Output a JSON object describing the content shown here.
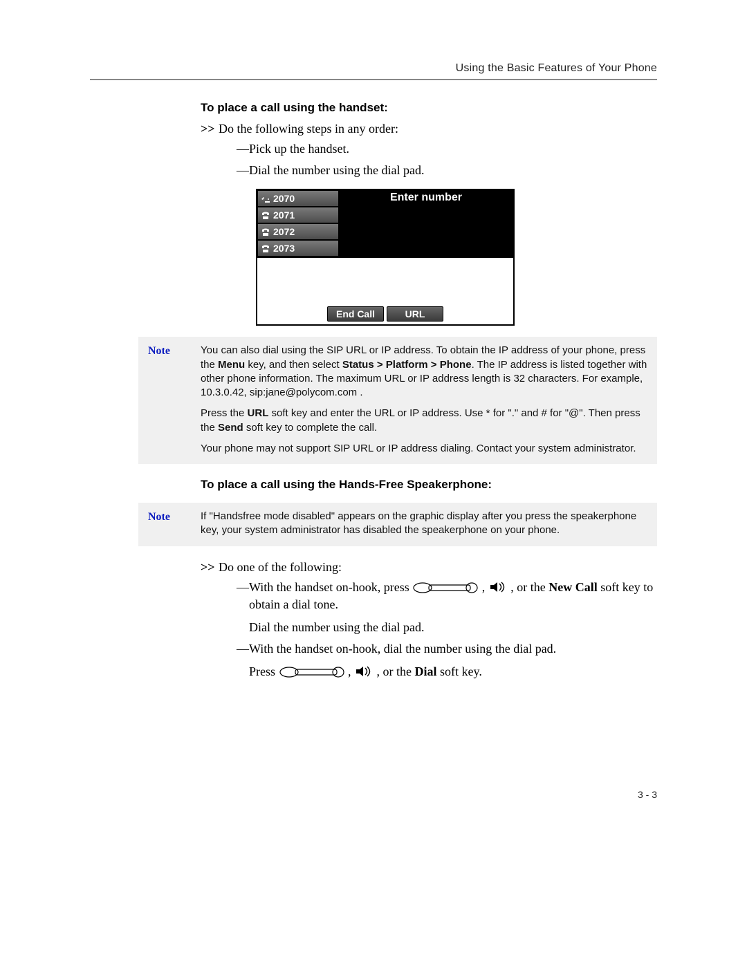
{
  "running_head": "Using the Basic Features of Your Phone",
  "page_number": "3 - 3",
  "section1": {
    "title": "To place a call using the handset:",
    "step_marker": ">>",
    "step_text": "Do the following steps in any order:",
    "bullet1": "Pick up the handset.",
    "bullet2": "Dial the number using the dial pad."
  },
  "phone_screen": {
    "line1": "2070",
    "line2": "2071",
    "line3": "2072",
    "line4": "2073",
    "title": "Enter number",
    "softkey1": "End Call",
    "softkey2": "URL"
  },
  "note1": {
    "label": "Note",
    "p1a": "You can also dial using the SIP URL or IP address. To obtain the IP address of your phone, press the ",
    "p1b_bold": "Menu",
    "p1c": " key, and then select ",
    "p1d_bold": "Status > Platform > Phone",
    "p1e": ". The IP address is listed together with other phone information. The maximum URL or IP address length is 32 characters. For example, 10.3.0.42, sip:jane@polycom.com .",
    "p2a": "Press the ",
    "p2b_bold": "URL",
    "p2c": " soft key and enter the URL or IP address. Use * for \".\" and # for \"@\". Then press the ",
    "p2d_bold": "Send",
    "p2e": " soft key to complete the call.",
    "p3": "Your phone may not support SIP URL or IP address dialing. Contact your system administrator."
  },
  "section2": {
    "title": "To place a call using the Hands-Free Speakerphone:"
  },
  "note2": {
    "label": "Note",
    "p1": "If \"Handsfree mode disabled\" appears on the graphic display after you press the speakerphone key, your system administrator has disabled the speakerphone on your phone."
  },
  "section3": {
    "step_marker": ">>",
    "step_text": "Do one of the following:",
    "b1a": "With the handset on-hook, press ",
    "b1b": ", ",
    "b1c": ", or the ",
    "b1d_bold": "New Call",
    "b1e": " soft key to obtain a dial tone.",
    "b1_sub": "Dial the number using the dial pad.",
    "b2a": "With the handset on-hook, dial the number using the dial pad.",
    "b2_sub_a": "Press ",
    "b2_sub_b": ", ",
    "b2_sub_c": ", or the ",
    "b2_sub_d_bold": "Dial",
    "b2_sub_e": " soft key."
  }
}
